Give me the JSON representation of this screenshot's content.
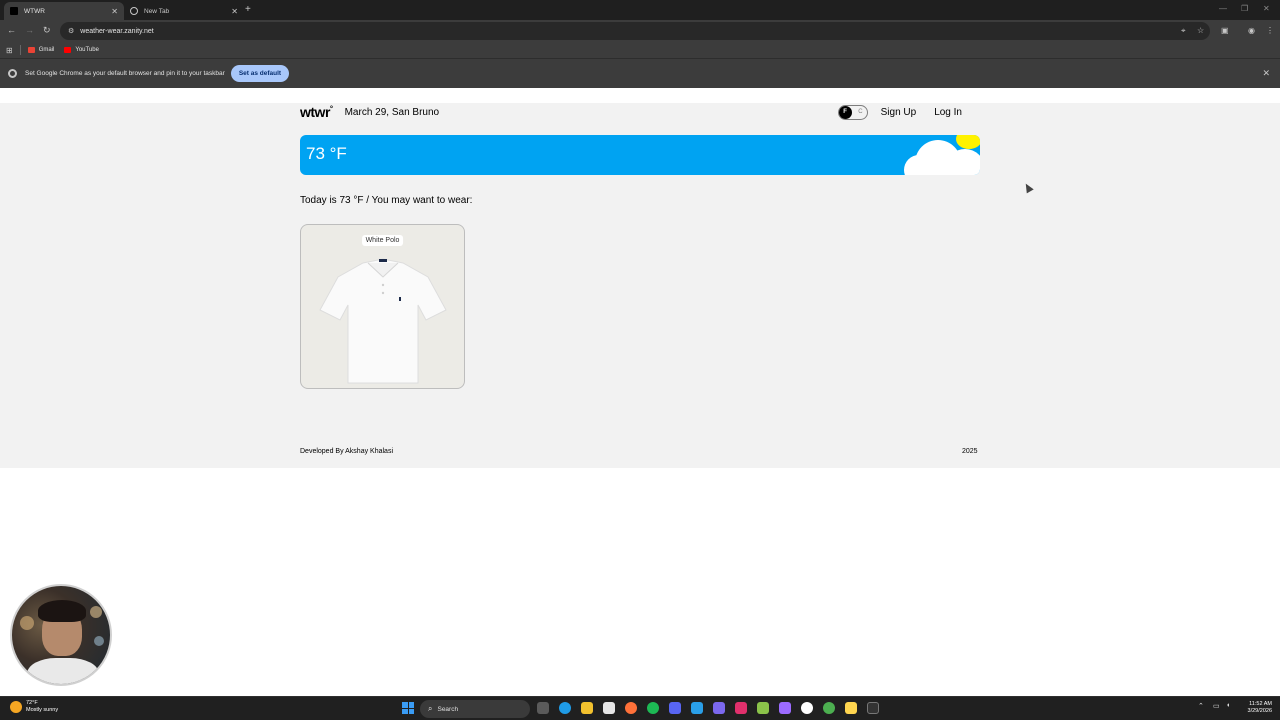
{
  "browser": {
    "tabs": [
      {
        "label": "WTWR",
        "active": true
      },
      {
        "label": "New Tab",
        "active": false
      }
    ],
    "url": "weather-wear.zanity.net",
    "bookmarks": [
      {
        "label": "Gmail",
        "color": "#ea4335"
      },
      {
        "label": "YouTube",
        "color": "#ff0000"
      }
    ],
    "infobar": {
      "message": "Set Google Chrome as your default browser and pin it to your taskbar",
      "button": "Set as default"
    }
  },
  "app": {
    "logo": "wtwr",
    "logo_mark": "°",
    "date_location": "March 29, San Bruno",
    "toggle": {
      "active": "F",
      "inactive": "C"
    },
    "nav": {
      "signup": "Sign Up",
      "login": "Log In"
    },
    "weather": {
      "temperature": "73 °F",
      "card_color": "#00a3f2",
      "sun_color": "#fff200"
    },
    "today_text": "Today is 73 °F / You may want to wear:",
    "items": [
      {
        "name": "White Polo"
      }
    ],
    "footer": {
      "developer": "Developed By Akshay Khalasi",
      "year": "2025"
    }
  },
  "taskbar": {
    "weather": {
      "temp": "72°F",
      "condition": "Mostly sunny"
    },
    "search_placeholder": "Search",
    "time": "11:52 AM",
    "date": "3/29/2026"
  }
}
